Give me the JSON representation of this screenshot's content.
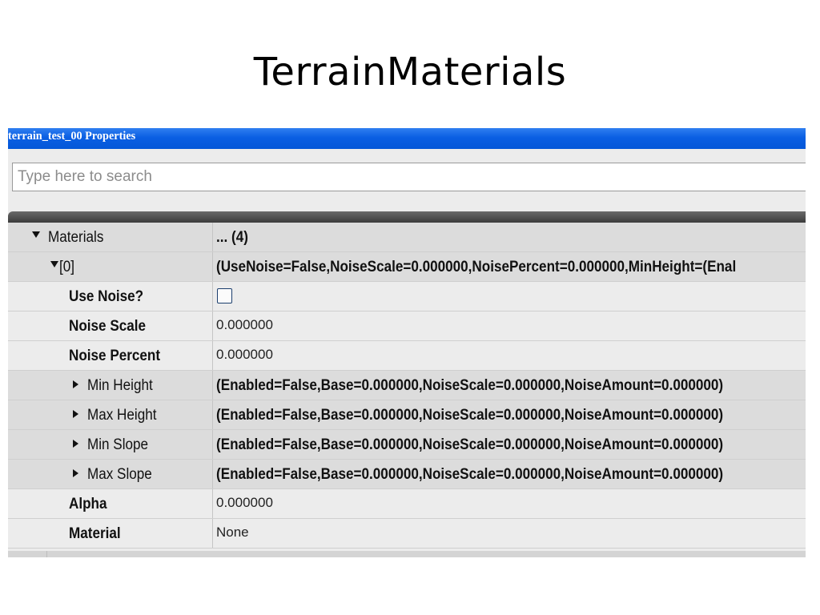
{
  "slide": {
    "title": "TerrainMaterials"
  },
  "window": {
    "title": "terrain_test_00 Properties"
  },
  "search": {
    "placeholder": "Type here to search",
    "value": ""
  },
  "properties": {
    "materials": {
      "label": "Materials",
      "value": "... (4)",
      "expanded": true
    },
    "item0": {
      "label": "[0]",
      "value": "(UseNoise=False,NoiseScale=0.000000,NoisePercent=0.000000,MinHeight=(Enal",
      "expanded": true
    },
    "use_noise": {
      "label": "Use Noise?",
      "checked": false
    },
    "noise_scale": {
      "label": "Noise Scale",
      "value": "0.000000"
    },
    "noise_percent": {
      "label": "Noise Percent",
      "value": "0.000000"
    },
    "min_height": {
      "label": "Min Height",
      "value": "(Enabled=False,Base=0.000000,NoiseScale=0.000000,NoiseAmount=0.000000)",
      "expanded": false
    },
    "max_height": {
      "label": "Max Height",
      "value": "(Enabled=False,Base=0.000000,NoiseScale=0.000000,NoiseAmount=0.000000)",
      "expanded": false
    },
    "min_slope": {
      "label": "Min Slope",
      "value": "(Enabled=False,Base=0.000000,NoiseScale=0.000000,NoiseAmount=0.000000)",
      "expanded": false
    },
    "max_slope": {
      "label": "Max Slope",
      "value": "(Enabled=False,Base=0.000000,NoiseScale=0.000000,NoiseAmount=0.000000)",
      "expanded": false
    },
    "alpha": {
      "label": "Alpha",
      "value": "0.000000"
    },
    "material": {
      "label": "Material",
      "value": "None"
    }
  },
  "colors": {
    "titlebar": "#0a5fe3",
    "row_background": "#ececec",
    "expandable_row_background": "#dcdcdc",
    "header_bar": "#3b3b3b"
  },
  "icons": {
    "expanded": "triangle-down-icon",
    "collapsed": "triangle-right-icon",
    "checkbox": "checkbox-icon"
  }
}
